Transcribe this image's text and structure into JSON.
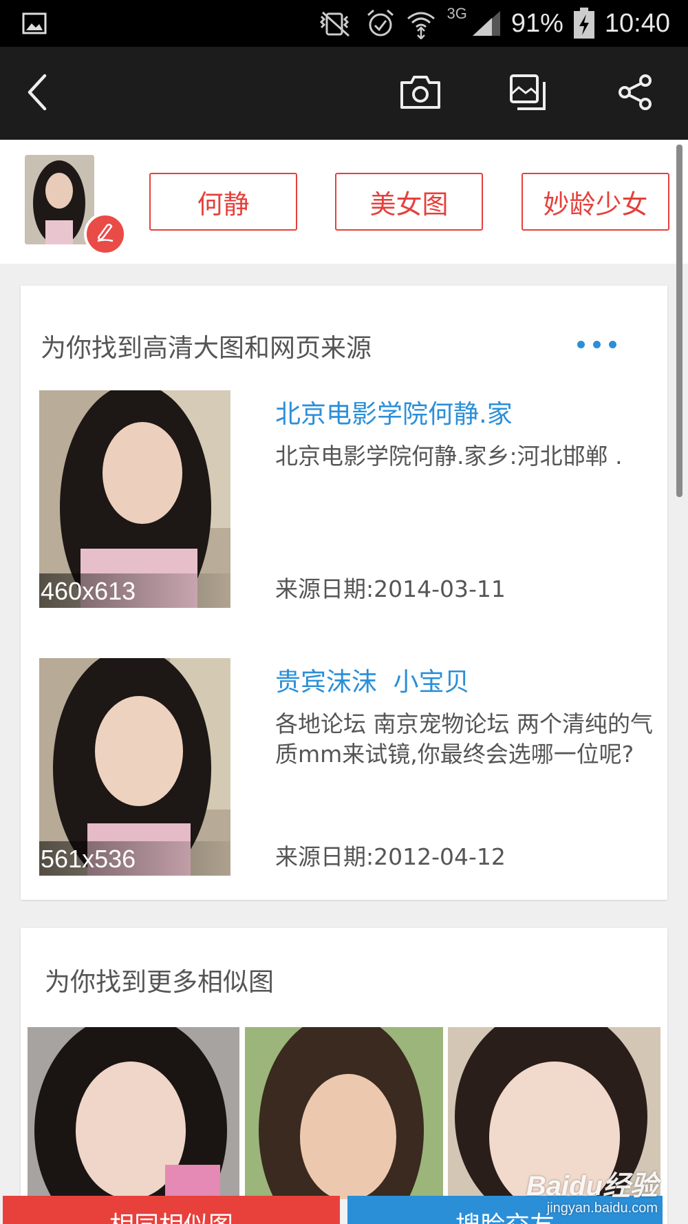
{
  "status_bar": {
    "battery": "91%",
    "time": "10:40",
    "network": "3G",
    "icons": [
      "gallery-icon",
      "vibrate-icon",
      "alarm-icon",
      "wifi-icon",
      "signal-icon",
      "battery-charging-icon"
    ]
  },
  "toolbar": {
    "icons": [
      "back-icon",
      "camera-icon",
      "crop-icon",
      "share-icon"
    ]
  },
  "tags": [
    "何静",
    "美女图",
    "妙龄少女"
  ],
  "sources_card": {
    "title": "为你找到高清大图和网页来源",
    "results": [
      {
        "dimensions": "460x613",
        "title": "北京电影学院何静.家",
        "description": "北京电影学院何静.家乡:河北邯郸 .",
        "date": "来源日期:2014-03-11"
      },
      {
        "dimensions": "561x536",
        "title": "贵宾沫沫  小宝贝",
        "description": "各地论坛 南京宠物论坛 两个清纯的气质mm来试镜,你最终会选哪一位呢?",
        "date": "来源日期:2012-04-12"
      }
    ]
  },
  "similar_card": {
    "title": "为你找到更多相似图"
  },
  "bottom_bar": {
    "left_label": "相同相似图",
    "right_label": "搜脸交友"
  },
  "watermark": {
    "brand": "Baidu经验",
    "url": "jingyan.baidu.com"
  },
  "colors": {
    "accent_red": "#e5403b",
    "link_blue": "#2b8fd8",
    "bottom_left_bg": "#e8413c",
    "bottom_right_bg": "#2b8fd8"
  }
}
